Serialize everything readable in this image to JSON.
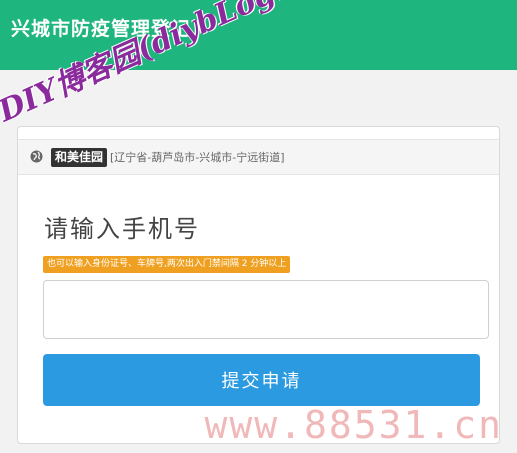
{
  "header": {
    "title": "兴城市防疫管理登记"
  },
  "location": {
    "icon": "globe-icon",
    "community": "和美佳园",
    "region": "[辽宁省-葫芦岛市-兴城市-宁远街道]"
  },
  "form": {
    "prompt": "请输入手机号",
    "hint": "也可以输入身份证号、车牌号,两次出入门禁间隔 2 分钟以上",
    "phone_value": "",
    "phone_placeholder": "",
    "submit_label": "提交申请"
  },
  "watermarks": {
    "blog": "DIY博客园(diybLoghome.com)",
    "url": "www.88531.cn"
  },
  "colors": {
    "header": "#1fb57f",
    "button": "#2b9ae0",
    "hint": "#f0a020"
  }
}
